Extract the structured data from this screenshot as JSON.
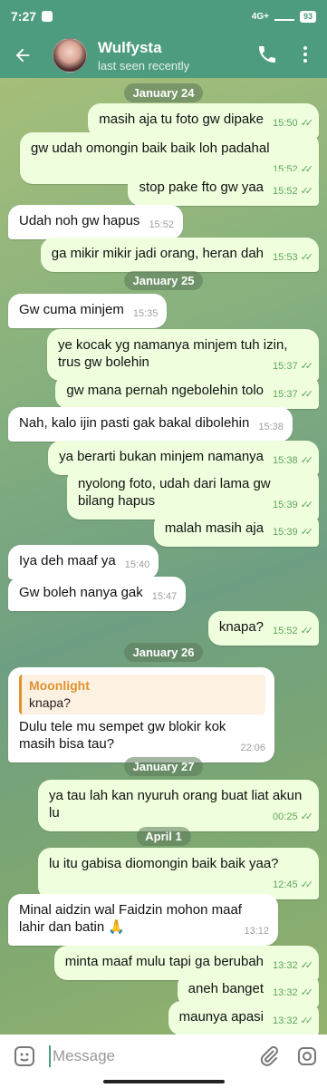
{
  "status": {
    "time": "7:27",
    "battery": "93",
    "network": "4G+"
  },
  "header": {
    "name": "Wulfysta",
    "subtitle": "last seen recently"
  },
  "dates": [
    "January 24",
    "January 25",
    "January 26",
    "January 27",
    "April 1"
  ],
  "messages": [
    {
      "dir": "out",
      "text": "masih aja tu foto gw dipake",
      "time": "15:50"
    },
    {
      "dir": "out",
      "text": "gw udah omongin baik baik loh padahal",
      "time": "15:52"
    },
    {
      "dir": "out",
      "text": "stop pake fto gw yaa",
      "time": "15:52"
    },
    {
      "dir": "in",
      "text": "Udah noh gw hapus",
      "time": "15:52"
    },
    {
      "dir": "out",
      "text": "ga mikir mikir jadi orang, heran dah",
      "time": "15:53"
    },
    {
      "dir": "in",
      "text": "Gw cuma minjem",
      "time": "15:35"
    },
    {
      "dir": "out",
      "text": "ye kocak yg namanya minjem tuh izin, trus gw bolehin",
      "time": "15:37"
    },
    {
      "dir": "out",
      "text": "gw mana pernah ngebolehin tolo",
      "time": "15:37"
    },
    {
      "dir": "in",
      "text": "Nah, kalo ijin pasti gak bakal dibolehin",
      "time": "15:38"
    },
    {
      "dir": "out",
      "text": "ya berarti bukan minjem namanya",
      "time": "15:38"
    },
    {
      "dir": "out",
      "text": "nyolong foto, udah dari lama gw bilang hapus",
      "time": "15:39"
    },
    {
      "dir": "out",
      "text": "malah masih aja",
      "time": "15:39"
    },
    {
      "dir": "in",
      "text": "Iya deh maaf ya",
      "time": "15:40"
    },
    {
      "dir": "in",
      "text": "Gw boleh nanya gak",
      "time": "15:47"
    },
    {
      "dir": "out",
      "text": "knapa?",
      "time": "15:52"
    },
    {
      "dir": "in",
      "reply_name": "Moonlight",
      "reply_text": "knapa?",
      "text": "Dulu tele mu sempet gw blokir kok masih bisa tau?",
      "time": "22:06"
    },
    {
      "dir": "out",
      "text": "ya tau lah kan nyuruh orang buat liat akun lu",
      "time": "00:25"
    },
    {
      "dir": "out",
      "text": "lu itu gabisa diomongin baik baik yaa?",
      "time": "12:45"
    },
    {
      "dir": "in",
      "text": "Minal aidzin wal Faidzin mohon maaf lahir dan batin 🙏",
      "time": "13:12"
    },
    {
      "dir": "out",
      "text": "minta maaf mulu tapi ga berubah",
      "time": "13:32"
    },
    {
      "dir": "out",
      "text": "aneh banget",
      "time": "13:32"
    },
    {
      "dir": "out",
      "text": "maunya apasi",
      "time": "13:32"
    }
  ],
  "input": {
    "placeholder": "Message"
  },
  "colors": {
    "header": "#4e9c80",
    "outgoing": "#effedd",
    "incoming": "#ffffff",
    "check": "#5fa55e"
  }
}
